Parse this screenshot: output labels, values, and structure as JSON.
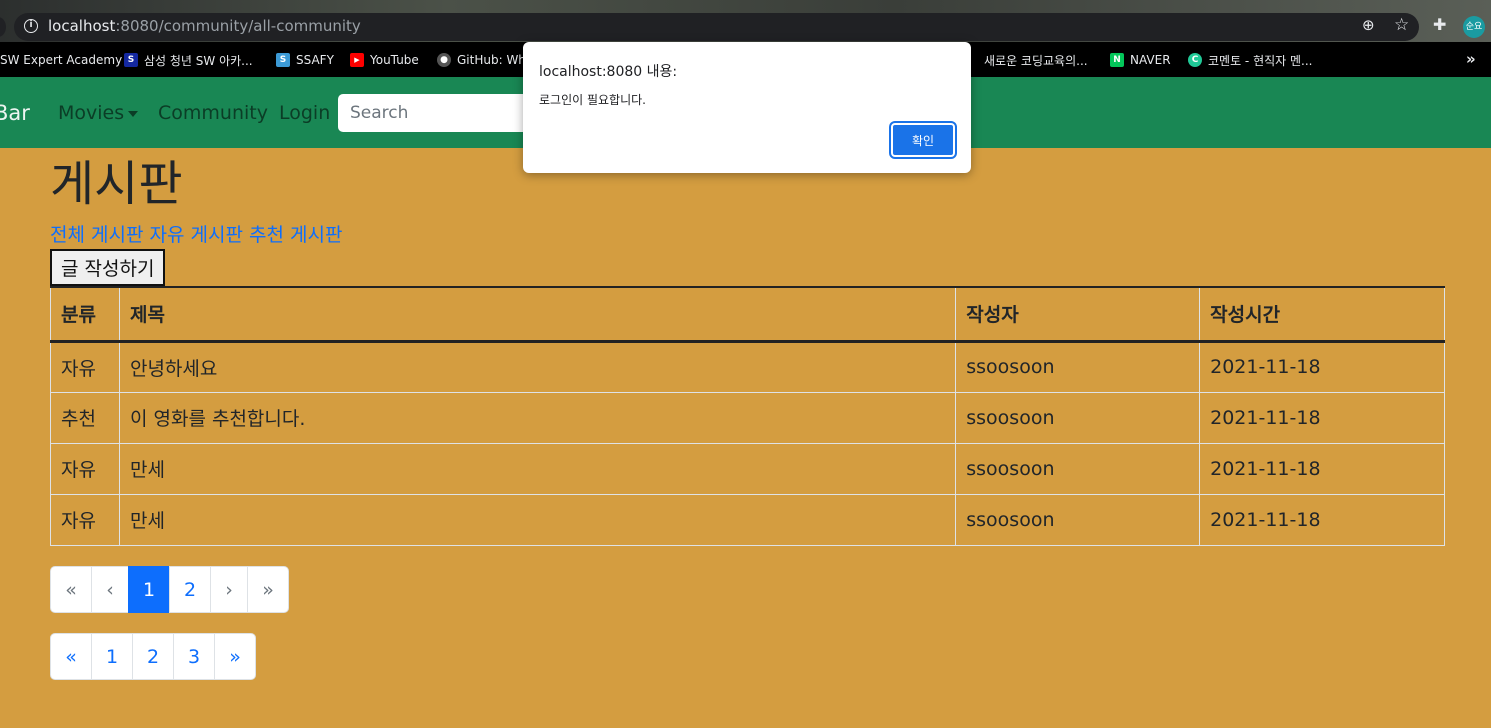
{
  "browser": {
    "url_host": "localhost",
    "url_rest": ":8080/community/all-community",
    "profile_initials": "순요"
  },
  "bookmarks": [
    {
      "label": "SW Expert Academy",
      "icon": "",
      "color": ""
    },
    {
      "label": "삼성 청년 SW 아카...",
      "icon": "S",
      "color": "#1428a0"
    },
    {
      "label": "SSAFY",
      "icon": "S",
      "color": "#3c9ad6"
    },
    {
      "label": "YouTube",
      "icon": "▶",
      "color": "#ff0000"
    },
    {
      "label": "GitHub: Wh",
      "icon": "●",
      "color": "#555555"
    },
    {
      "label": "새로운 코딩교육의...",
      "icon": "",
      "color": ""
    },
    {
      "label": "NAVER",
      "icon": "N",
      "color": "#03c75a"
    },
    {
      "label": "코멘토 - 현직자 멘...",
      "icon": "C",
      "color": "#20c997"
    }
  ],
  "navbar": {
    "brand": "Bar",
    "links": [
      "Movies",
      "Community",
      "Login"
    ],
    "search_placeholder": "Search"
  },
  "page": {
    "title": "게시판",
    "board_links": [
      "전체 게시판",
      "자유 게시판",
      "추천 게시판"
    ],
    "write_button": "글 작성하기"
  },
  "table": {
    "headers": [
      "분류",
      "제목",
      "작성자",
      "작성시간"
    ],
    "rows": [
      [
        "자유",
        "안녕하세요",
        "ssoosoon",
        "2021-11-18"
      ],
      [
        "추천",
        "이 영화를 추천합니다.",
        "ssoosoon",
        "2021-11-18"
      ],
      [
        "자유",
        "만세",
        "ssoosoon",
        "2021-11-18"
      ],
      [
        "자유",
        "만세",
        "ssoosoon",
        "2021-11-18"
      ]
    ]
  },
  "pagination_1": {
    "items": [
      "«",
      "‹",
      "1",
      "2",
      "›",
      "»"
    ],
    "active": "1"
  },
  "pagination_2": {
    "items": [
      "«",
      "1",
      "2",
      "3",
      "»"
    ]
  },
  "dialog": {
    "title": "localhost:8080 내용:",
    "message": "로그인이 필요합니다.",
    "ok_label": "확인"
  }
}
